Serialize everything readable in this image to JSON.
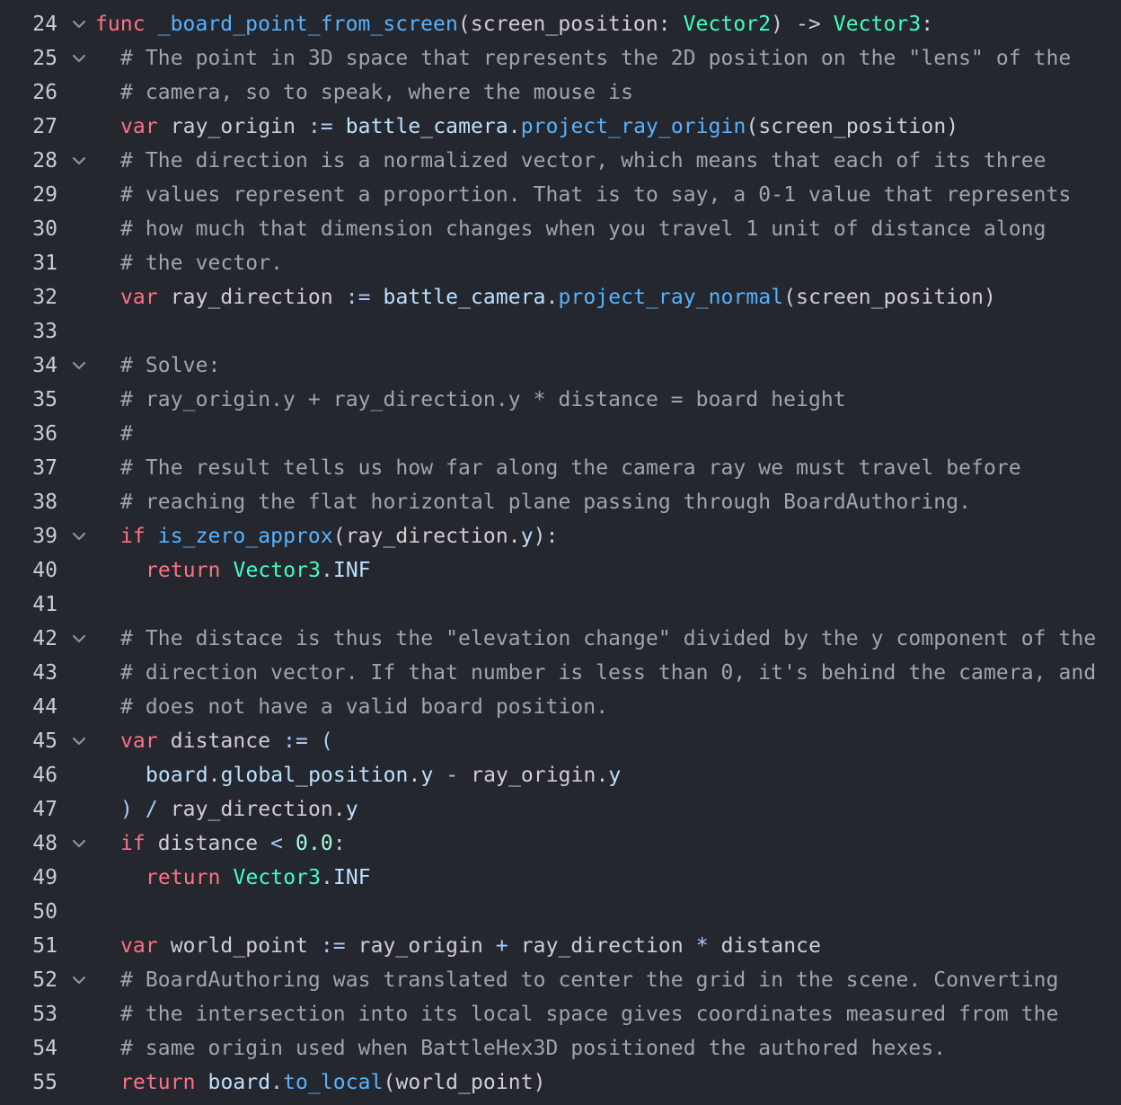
{
  "editor": {
    "lines": [
      {
        "num": "24",
        "fold": true,
        "indent": 0,
        "tokens": [
          {
            "t": "func",
            "c": "kw"
          },
          {
            "t": " ",
            "c": "id"
          },
          {
            "t": "_board_point_from_screen",
            "c": "fnname"
          },
          {
            "t": "(screen_position: ",
            "c": "id"
          },
          {
            "t": "Vector2",
            "c": "type"
          },
          {
            "t": ") -> ",
            "c": "id"
          },
          {
            "t": "Vector3",
            "c": "type"
          },
          {
            "t": ":",
            "c": "id"
          }
        ]
      },
      {
        "num": "25",
        "fold": true,
        "indent": 1,
        "tokens": [
          {
            "t": "# The point in 3D space that represents the 2D position on the \"lens\" of the",
            "c": "cm"
          }
        ]
      },
      {
        "num": "26",
        "fold": false,
        "indent": 1,
        "tokens": [
          {
            "t": "# camera, so to speak, where the mouse is",
            "c": "cm"
          }
        ]
      },
      {
        "num": "27",
        "fold": false,
        "indent": 1,
        "tokens": [
          {
            "t": "var",
            "c": "kw"
          },
          {
            "t": " ray_origin ",
            "c": "id"
          },
          {
            "t": ":=",
            "c": "op"
          },
          {
            "t": " ",
            "c": "id"
          },
          {
            "t": "battle_camera",
            "c": "member"
          },
          {
            "t": ".",
            "c": "id"
          },
          {
            "t": "project_ray_origin",
            "c": "fn"
          },
          {
            "t": "(screen_position)",
            "c": "id"
          }
        ]
      },
      {
        "num": "28",
        "fold": true,
        "indent": 1,
        "tokens": [
          {
            "t": "# The direction is a normalized vector, which means that each of its three",
            "c": "cm"
          }
        ]
      },
      {
        "num": "29",
        "fold": false,
        "indent": 1,
        "tokens": [
          {
            "t": "# values represent a proportion. That is to say, a 0-1 value that represents",
            "c": "cm"
          }
        ]
      },
      {
        "num": "30",
        "fold": false,
        "indent": 1,
        "tokens": [
          {
            "t": "# how much that dimension changes when you travel 1 unit of distance along",
            "c": "cm"
          }
        ]
      },
      {
        "num": "31",
        "fold": false,
        "indent": 1,
        "tokens": [
          {
            "t": "# the vector.",
            "c": "cm"
          }
        ]
      },
      {
        "num": "32",
        "fold": false,
        "indent": 1,
        "tokens": [
          {
            "t": "var",
            "c": "kw"
          },
          {
            "t": " ray_direction ",
            "c": "id"
          },
          {
            "t": ":=",
            "c": "op"
          },
          {
            "t": " ",
            "c": "id"
          },
          {
            "t": "battle_camera",
            "c": "member"
          },
          {
            "t": ".",
            "c": "id"
          },
          {
            "t": "project_ray_normal",
            "c": "fn"
          },
          {
            "t": "(screen_position)",
            "c": "id"
          }
        ]
      },
      {
        "num": "33",
        "fold": false,
        "indent": 1,
        "tokens": []
      },
      {
        "num": "34",
        "fold": true,
        "indent": 1,
        "tokens": [
          {
            "t": "# Solve:",
            "c": "cm"
          }
        ]
      },
      {
        "num": "35",
        "fold": false,
        "indent": 1,
        "tokens": [
          {
            "t": "# ray_origin.y + ray_direction.y * distance = board height",
            "c": "cm"
          }
        ]
      },
      {
        "num": "36",
        "fold": false,
        "indent": 1,
        "tokens": [
          {
            "t": "#",
            "c": "cm"
          }
        ]
      },
      {
        "num": "37",
        "fold": false,
        "indent": 1,
        "tokens": [
          {
            "t": "# The result tells us how far along the camera ray we must travel before",
            "c": "cm"
          }
        ]
      },
      {
        "num": "38",
        "fold": false,
        "indent": 1,
        "tokens": [
          {
            "t": "# reaching the flat horizontal plane passing through BoardAuthoring.",
            "c": "cm"
          }
        ]
      },
      {
        "num": "39",
        "fold": true,
        "indent": 1,
        "tokens": [
          {
            "t": "if",
            "c": "kw"
          },
          {
            "t": " ",
            "c": "id"
          },
          {
            "t": "is_zero_approx",
            "c": "fn"
          },
          {
            "t": "(ray_direction.",
            "c": "id"
          },
          {
            "t": "y",
            "c": "member"
          },
          {
            "t": "):",
            "c": "id"
          }
        ]
      },
      {
        "num": "40",
        "fold": false,
        "indent": 2,
        "tokens": [
          {
            "t": "return",
            "c": "kw"
          },
          {
            "t": " ",
            "c": "id"
          },
          {
            "t": "Vector3",
            "c": "type"
          },
          {
            "t": ".",
            "c": "id"
          },
          {
            "t": "INF",
            "c": "member"
          }
        ]
      },
      {
        "num": "41",
        "fold": false,
        "indent": 1,
        "tokens": []
      },
      {
        "num": "42",
        "fold": true,
        "indent": 1,
        "tokens": [
          {
            "t": "# The distace is thus the \"elevation change\" divided by the y component of the",
            "c": "cm"
          }
        ]
      },
      {
        "num": "43",
        "fold": false,
        "indent": 1,
        "tokens": [
          {
            "t": "# direction vector. If that number is less than 0, it's behind the camera, and",
            "c": "cm"
          }
        ]
      },
      {
        "num": "44",
        "fold": false,
        "indent": 1,
        "tokens": [
          {
            "t": "# does not have a valid board position.",
            "c": "cm"
          }
        ]
      },
      {
        "num": "45",
        "fold": true,
        "indent": 1,
        "tokens": [
          {
            "t": "var",
            "c": "kw"
          },
          {
            "t": " distance ",
            "c": "id"
          },
          {
            "t": ":=",
            "c": "op"
          },
          {
            "t": " ",
            "c": "id"
          },
          {
            "t": "(",
            "c": "op"
          }
        ]
      },
      {
        "num": "46",
        "fold": false,
        "indent": 2,
        "tokens": [
          {
            "t": "board",
            "c": "member"
          },
          {
            "t": ".",
            "c": "id"
          },
          {
            "t": "global_position",
            "c": "member"
          },
          {
            "t": ".",
            "c": "id"
          },
          {
            "t": "y",
            "c": "member"
          },
          {
            "t": " ",
            "c": "id"
          },
          {
            "t": "-",
            "c": "op"
          },
          {
            "t": " ray_origin.",
            "c": "id"
          },
          {
            "t": "y",
            "c": "member"
          }
        ]
      },
      {
        "num": "47",
        "fold": false,
        "indent": 1,
        "tokens": [
          {
            "t": ")",
            "c": "op"
          },
          {
            "t": " ",
            "c": "id"
          },
          {
            "t": "/",
            "c": "op"
          },
          {
            "t": " ray_direction.",
            "c": "id"
          },
          {
            "t": "y",
            "c": "member"
          }
        ]
      },
      {
        "num": "48",
        "fold": true,
        "indent": 1,
        "tokens": [
          {
            "t": "if",
            "c": "kw"
          },
          {
            "t": " distance ",
            "c": "id"
          },
          {
            "t": "<",
            "c": "op"
          },
          {
            "t": " ",
            "c": "id"
          },
          {
            "t": "0.0",
            "c": "num"
          },
          {
            "t": ":",
            "c": "id"
          }
        ]
      },
      {
        "num": "49",
        "fold": false,
        "indent": 2,
        "tokens": [
          {
            "t": "return",
            "c": "kw"
          },
          {
            "t": " ",
            "c": "id"
          },
          {
            "t": "Vector3",
            "c": "type"
          },
          {
            "t": ".",
            "c": "id"
          },
          {
            "t": "INF",
            "c": "member"
          }
        ]
      },
      {
        "num": "50",
        "fold": false,
        "indent": 1,
        "tokens": []
      },
      {
        "num": "51",
        "fold": false,
        "indent": 1,
        "tokens": [
          {
            "t": "var",
            "c": "kw"
          },
          {
            "t": " world_point ",
            "c": "id"
          },
          {
            "t": ":=",
            "c": "op"
          },
          {
            "t": " ray_origin ",
            "c": "id"
          },
          {
            "t": "+",
            "c": "op"
          },
          {
            "t": " ray_direction ",
            "c": "id"
          },
          {
            "t": "*",
            "c": "op"
          },
          {
            "t": " distance",
            "c": "id"
          }
        ]
      },
      {
        "num": "52",
        "fold": true,
        "indent": 1,
        "tokens": [
          {
            "t": "# BoardAuthoring was translated to center the grid in the scene. Converting",
            "c": "cm"
          }
        ]
      },
      {
        "num": "53",
        "fold": false,
        "indent": 1,
        "tokens": [
          {
            "t": "# the intersection into its local space gives coordinates measured from the",
            "c": "cm"
          }
        ]
      },
      {
        "num": "54",
        "fold": false,
        "indent": 1,
        "tokens": [
          {
            "t": "# same origin used when BattleHex3D positioned the authored hexes.",
            "c": "cm"
          }
        ]
      },
      {
        "num": "55",
        "fold": false,
        "indent": 1,
        "tokens": [
          {
            "t": "return",
            "c": "kw"
          },
          {
            "t": " ",
            "c": "id"
          },
          {
            "t": "board",
            "c": "member"
          },
          {
            "t": ".",
            "c": "id"
          },
          {
            "t": "to_local",
            "c": "fn"
          },
          {
            "t": "(world_point)",
            "c": "id"
          }
        ]
      }
    ],
    "fold_icon": "chevron-down-icon",
    "colors": {
      "background": "#24272d",
      "keyword": "#ff7085",
      "function": "#57b2ff",
      "type": "#42ffc2",
      "comment": "#a1a5ab",
      "operator": "#abc9ff",
      "number": "#a1ffe0",
      "line_number": "#c9ccd1"
    }
  }
}
